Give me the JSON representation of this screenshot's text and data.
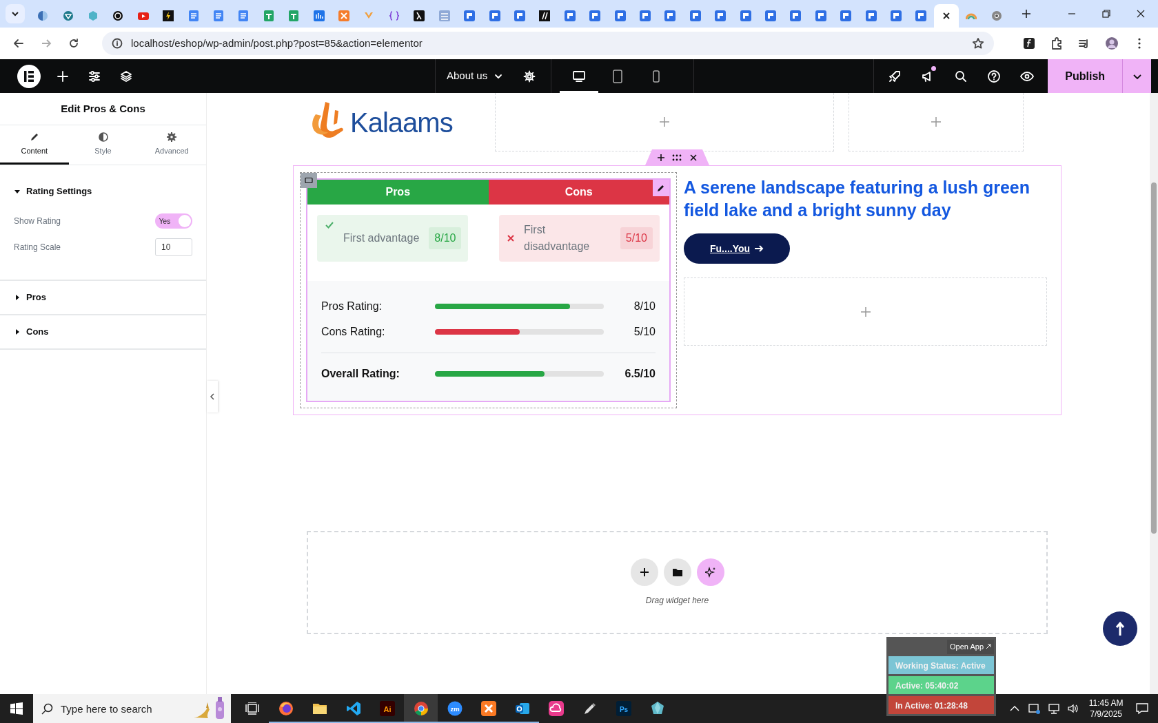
{
  "browser": {
    "tabs": [
      {
        "kind": "globe",
        "selected": false
      },
      {
        "kind": "shield",
        "selected": false
      },
      {
        "kind": "hex",
        "selected": false
      },
      {
        "kind": "ring",
        "selected": false
      },
      {
        "kind": "video",
        "selected": false
      },
      {
        "kind": "bolt",
        "selected": false
      },
      {
        "kind": "doc",
        "selected": false
      },
      {
        "kind": "doc",
        "selected": false
      },
      {
        "kind": "doc",
        "selected": false
      },
      {
        "kind": "sheet",
        "selected": false
      },
      {
        "kind": "sheet",
        "selected": false
      },
      {
        "kind": "chart",
        "selected": false
      },
      {
        "kind": "xampp",
        "selected": false
      },
      {
        "kind": "vee",
        "selected": false
      },
      {
        "kind": "braces",
        "selected": false
      },
      {
        "kind": "lambda",
        "selected": false
      },
      {
        "kind": "grid",
        "selected": false
      },
      {
        "kind": "form",
        "selected": false
      },
      {
        "kind": "form",
        "selected": false
      },
      {
        "kind": "form",
        "selected": false
      },
      {
        "kind": "slash",
        "selected": false
      },
      {
        "kind": "form",
        "selected": false
      },
      {
        "kind": "form",
        "selected": false
      },
      {
        "kind": "form",
        "selected": false
      },
      {
        "kind": "form",
        "selected": false
      },
      {
        "kind": "form",
        "selected": false
      },
      {
        "kind": "form",
        "selected": false
      },
      {
        "kind": "form",
        "selected": false
      },
      {
        "kind": "form",
        "selected": false
      },
      {
        "kind": "form",
        "selected": false
      },
      {
        "kind": "form",
        "selected": false
      },
      {
        "kind": "form",
        "selected": false
      },
      {
        "kind": "form",
        "selected": false
      },
      {
        "kind": "form",
        "selected": false
      },
      {
        "kind": "form",
        "selected": false
      },
      {
        "kind": "form",
        "selected": false
      },
      {
        "kind": "blank",
        "selected": true
      },
      {
        "kind": "rainbow",
        "selected": false
      },
      {
        "kind": "chrome",
        "selected": false
      }
    ],
    "address": "localhost/eshop/wp-admin/post.php?post=85&action=elementor"
  },
  "editor_bar": {
    "page_menu": "About us",
    "devices": [
      {
        "kind": "desktop",
        "selected": true
      },
      {
        "kind": "tablet",
        "selected": false
      },
      {
        "kind": "mobile",
        "selected": false
      }
    ],
    "notification_dot": true,
    "publish": "Publish"
  },
  "panel": {
    "title": "Edit Pros & Cons",
    "tabs": [
      {
        "label": "Content",
        "kind": "pencil",
        "selected": true
      },
      {
        "label": "Style",
        "kind": "contrast",
        "selected": false
      },
      {
        "label": "Advanced",
        "kind": "gear",
        "selected": false
      }
    ],
    "sections": [
      {
        "title": "Rating Settings",
        "expanded": true,
        "fields": [
          {
            "kind": "toggle",
            "label": "Show Rating",
            "on": true,
            "value": "Yes"
          },
          {
            "kind": "number",
            "label": "Rating Scale",
            "value": "10"
          }
        ]
      },
      {
        "title": "Pros",
        "expanded": false
      },
      {
        "title": "Cons",
        "expanded": false
      }
    ]
  },
  "canvas": {
    "logo_text": "Kalaams",
    "widget": {
      "pros_title": "Pros",
      "cons_title": "Cons",
      "pros": [
        {
          "text": "First advantage",
          "score": "8/10"
        }
      ],
      "cons": [
        {
          "text": "First disadvantage",
          "score": "5/10"
        }
      ],
      "ratings": [
        {
          "kind": "item",
          "label": "Pros Rating:",
          "level": 0.8,
          "reading": "8/10",
          "color": "#28a745"
        },
        {
          "kind": "item",
          "label": "Cons Rating:",
          "level": 0.5,
          "reading": "5/10",
          "color": "#dc3545"
        },
        {
          "kind": "overall",
          "label": "Overall Rating:",
          "level": 0.65,
          "reading": "6.5/10",
          "color": "#28a745"
        }
      ]
    },
    "heading": "A serene landscape featuring a lush green field lake and a bright sunny day",
    "button": "Fu....You",
    "drop_hint": "Drag widget here"
  },
  "tracker": {
    "open_app": "Open App",
    "rows": [
      {
        "text": "Working Status: Active",
        "color": "#7cc5d5"
      },
      {
        "text": "Active: 05:40:02",
        "color": "#5cd38b"
      },
      {
        "text": "In Active: 01:28:48",
        "color": "#c2453a"
      }
    ]
  },
  "taskbar": {
    "search": {
      "placeholder": "Type here to search"
    },
    "apps": [
      {
        "kind": "firefox",
        "running": true,
        "selected": false
      },
      {
        "kind": "folder",
        "running": true,
        "selected": false
      },
      {
        "kind": "vscode",
        "running": true,
        "selected": false
      },
      {
        "kind": "illustrator",
        "label": "Ai",
        "running": true,
        "selected": false
      },
      {
        "kind": "chrome",
        "running": true,
        "selected": true
      },
      {
        "kind": "zoom",
        "label": "zm",
        "running": true,
        "selected": false
      },
      {
        "kind": "xampp",
        "running": true,
        "selected": false
      },
      {
        "kind": "outlook",
        "running": true,
        "selected": false
      },
      {
        "kind": "cloud",
        "running": false,
        "selected": false
      },
      {
        "kind": "pen",
        "running": false,
        "selected": false
      },
      {
        "kind": "photoshop",
        "label": "Ps",
        "running": false,
        "selected": false
      },
      {
        "kind": "crystal",
        "running": false,
        "selected": false
      }
    ],
    "clock": {
      "time": "11:45 AM",
      "date": "7/9/2025"
    }
  }
}
